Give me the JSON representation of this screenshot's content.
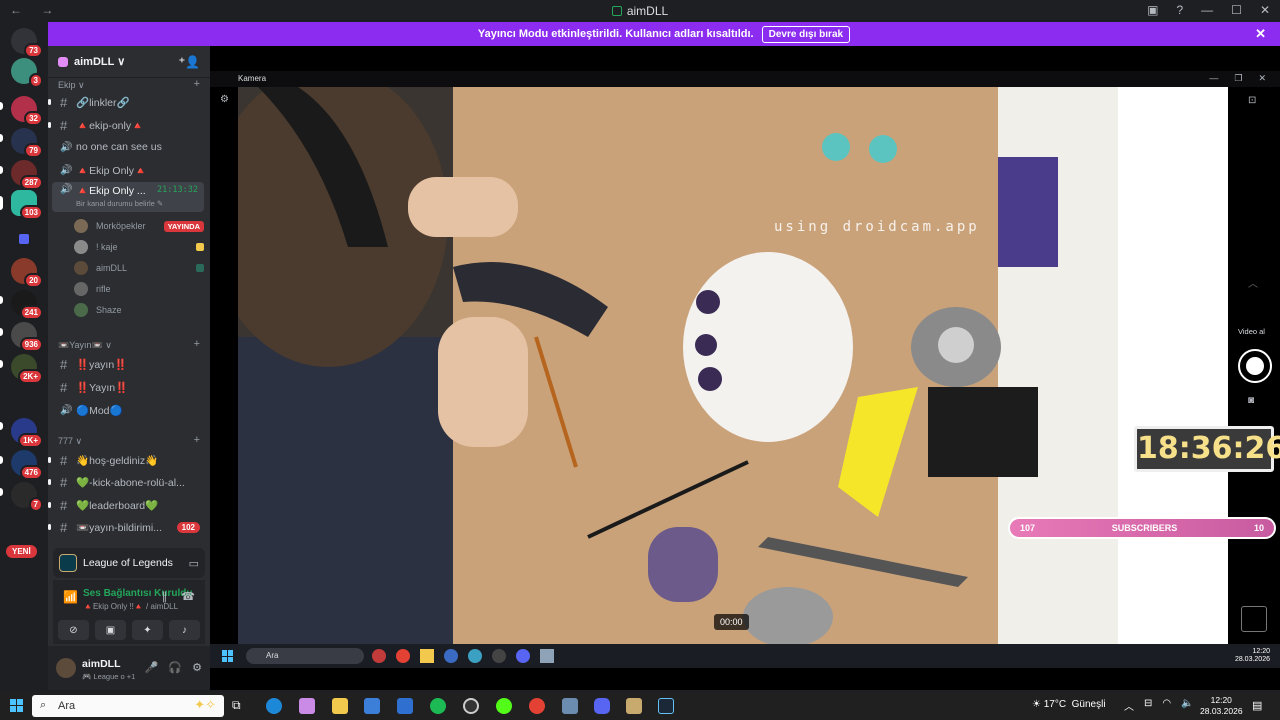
{
  "window": {
    "title": "aimDLL",
    "nav": "← →"
  },
  "banner": {
    "text": "Yayıncı Modu etkinleştirildi. Kullanıcı adları kısaltıldı.",
    "button": "Devre dışı bırak",
    "close": "✕"
  },
  "guild_badges": [
    "73",
    "3",
    "32",
    "79",
    "287",
    "103",
    "20",
    "241",
    "936",
    "2K+",
    "1K+",
    "476",
    "7"
  ],
  "new_label": "YENİ",
  "server": {
    "name": "aimDLL ∨",
    "categories": {
      "ekip": "Ekip ∨",
      "yayin": "📼Yayın📼 ∨",
      "seven": "777 ∨"
    },
    "channels": [
      {
        "name": "🔗linkler🔗"
      },
      {
        "name": "🔺ekip-only🔺"
      },
      {
        "name": "no one can see us"
      },
      {
        "name": "🔺Ekip Only🔺"
      },
      {
        "name": "🔺Ekip Only ...",
        "time": "21:13:32",
        "sub": "Bir kanal durumu belirle ✎"
      },
      {
        "name": "‼️yayın‼️"
      },
      {
        "name": "‼️Yayın‼️"
      },
      {
        "name": "🔵Mod🔵"
      },
      {
        "name": "👋hoş-geldiniz👋"
      },
      {
        "name": "💚-kick-abone-rolü-al..."
      },
      {
        "name": "💚leaderboard💚"
      },
      {
        "name": "📼yayın-bildirimi...",
        "mentions": "102"
      }
    ],
    "voice_users": [
      {
        "name": "Morköpekler",
        "badge": "YAYINDA"
      },
      {
        "name": "! kaje"
      },
      {
        "name": "aimDLL"
      },
      {
        "name": "rifle"
      },
      {
        "name": "Shaze"
      }
    ]
  },
  "activity": {
    "game": "League of Legends"
  },
  "voice": {
    "status": "Ses Bağlantısı Kuruldu",
    "channel": "🔺Ekip Only !!🔺 / aimDLL"
  },
  "user": {
    "name": "aimDLL",
    "status": "🎮 League o +1"
  },
  "camera": {
    "title": "Kamera",
    "watermark": "using droidcam.app",
    "video_label": "Video al",
    "clock": "18:36:26",
    "subs_left": "107",
    "subs_label": "SUBSCRIBERS",
    "subs_right": "10",
    "timestamp": "00:00",
    "inner_search": "Ara",
    "inner_time": "12:20",
    "inner_date": "28.03.2026"
  },
  "taskbar": {
    "search": "Ara",
    "weather_temp": "17°C",
    "weather_desc": "Güneşli",
    "time": "12:20",
    "date": "28.03.2026"
  },
  "colors": {
    "banner": "#8b2cf0",
    "sidebar": "#2b2d31",
    "connected": "#23a55a",
    "badge": "#da373c"
  }
}
